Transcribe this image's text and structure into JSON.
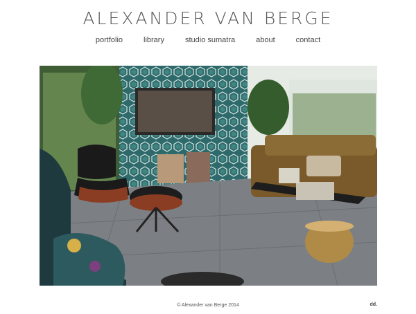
{
  "header": {
    "site_title": "ALEXANDER VAN BERGE"
  },
  "nav": {
    "items": [
      {
        "label": "portfolio"
      },
      {
        "label": "library"
      },
      {
        "label": "studio sumatra"
      },
      {
        "label": "about"
      },
      {
        "label": "contact"
      }
    ]
  },
  "footer": {
    "copyright": "© Alexander van Berge 2014",
    "credit": "dd."
  },
  "colors": {
    "wallpaper_teal": "#2f6b6a",
    "sofa": "#7a5a2a",
    "floor": "#7d8185"
  }
}
